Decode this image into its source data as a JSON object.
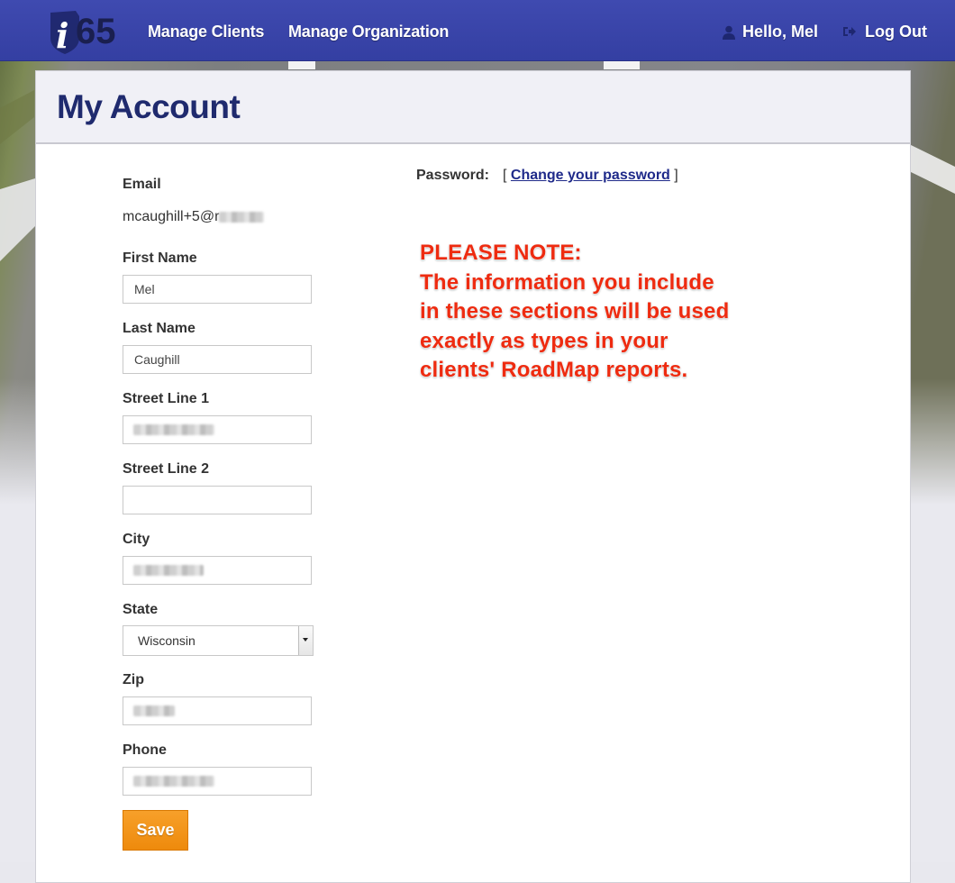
{
  "header": {
    "logo_text": "i65",
    "nav": {
      "manage_clients": "Manage Clients",
      "manage_organization": "Manage Organization"
    },
    "greeting": "Hello, Mel",
    "logout": "Log Out",
    "icons": {
      "user": "user-icon",
      "logout": "logout-icon"
    }
  },
  "page": {
    "title": "My Account"
  },
  "form": {
    "email": {
      "label": "Email",
      "value": "mcaughill+5@r"
    },
    "first_name": {
      "label": "First Name",
      "value": "Mel"
    },
    "last_name": {
      "label": "Last Name",
      "value": "Caughill"
    },
    "street1": {
      "label": "Street Line 1",
      "value": ""
    },
    "street2": {
      "label": "Street Line 2",
      "value": ""
    },
    "city": {
      "label": "City",
      "value": ""
    },
    "state": {
      "label": "State",
      "value": "Wisconsin"
    },
    "zip": {
      "label": "Zip",
      "value": ""
    },
    "phone": {
      "label": "Phone",
      "value": ""
    },
    "save_label": "Save"
  },
  "password": {
    "label": "Password:",
    "bracket_open": "[",
    "link": "Change your password",
    "bracket_close": "]"
  },
  "note": {
    "lines": [
      "PLEASE NOTE:",
      "The information you include",
      "in these sections will be used",
      "exactly as types in your",
      "clients' RoadMap reports."
    ],
    "color": "#ee2b10"
  },
  "colors": {
    "header": "#3f4ab0",
    "title": "#1f2a6e",
    "save": "#f29318"
  }
}
